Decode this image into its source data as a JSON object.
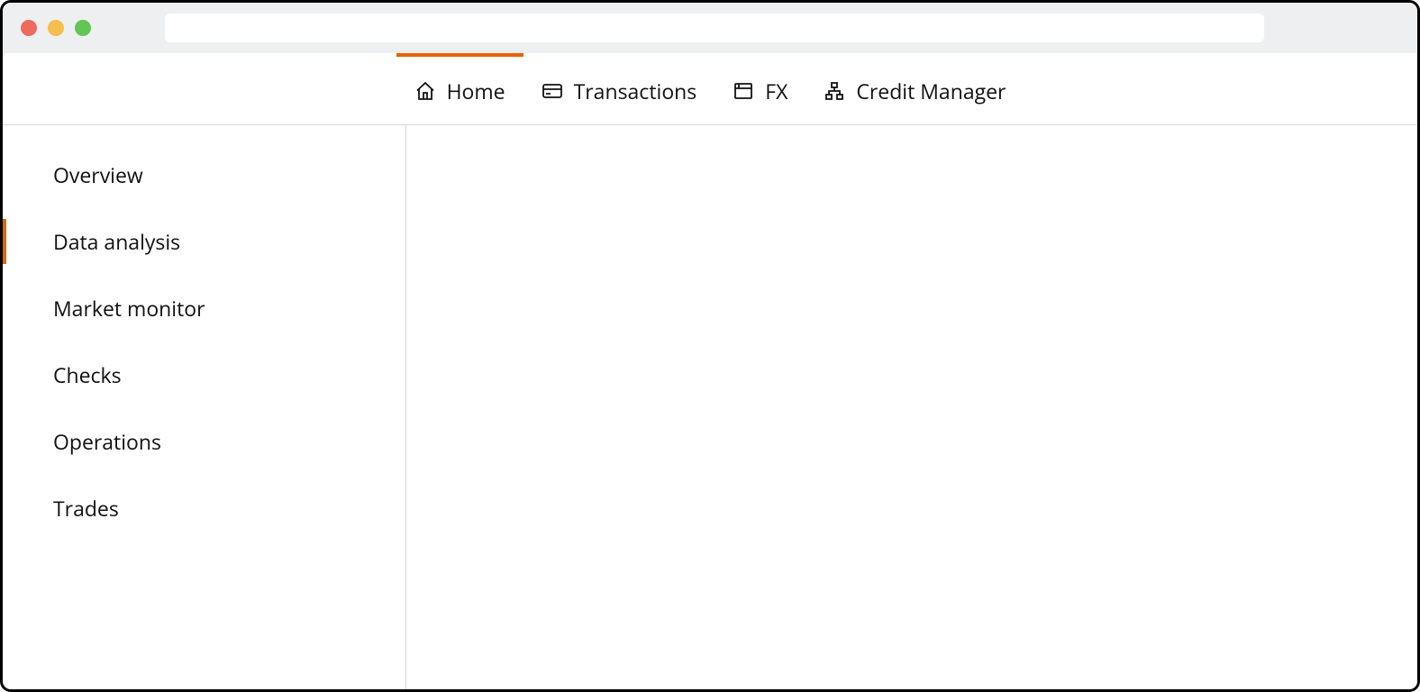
{
  "accent_color": "#e86100",
  "top_nav": {
    "active_index": 0,
    "items": [
      {
        "label": "Home",
        "icon": "home-icon"
      },
      {
        "label": "Transactions",
        "icon": "card-icon"
      },
      {
        "label": "FX",
        "icon": "window-icon"
      },
      {
        "label": "Credit Manager",
        "icon": "org-icon"
      }
    ]
  },
  "sidebar": {
    "active_index": 1,
    "items": [
      {
        "label": "Overview"
      },
      {
        "label": "Data analysis"
      },
      {
        "label": "Market monitor"
      },
      {
        "label": "Checks"
      },
      {
        "label": "Operations"
      },
      {
        "label": "Trades"
      }
    ]
  }
}
